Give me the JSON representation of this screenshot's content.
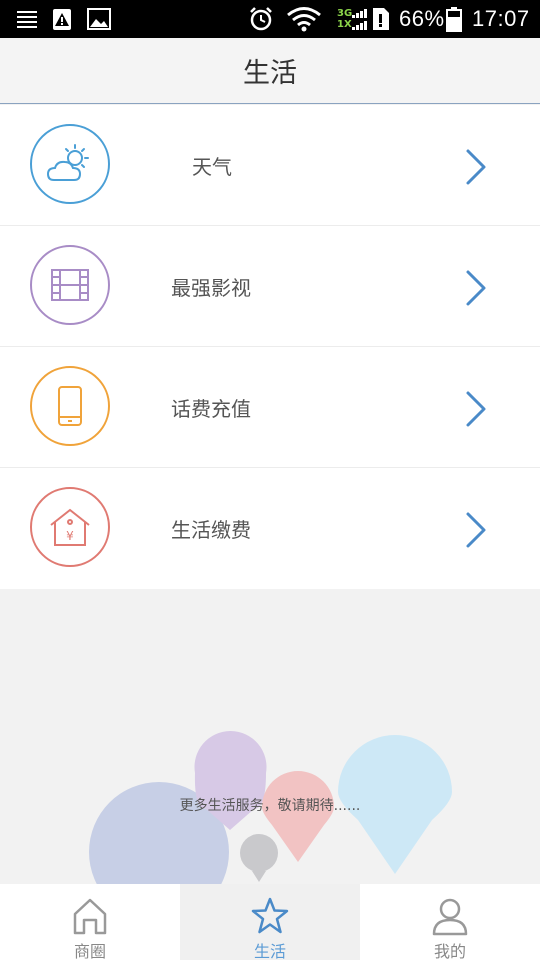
{
  "status_bar": {
    "battery": "66%",
    "time": "17:07",
    "network_top": "3G",
    "network_bottom": "1X"
  },
  "header": {
    "title": "生活"
  },
  "services": [
    {
      "label": "天气",
      "icon": "weather-icon",
      "color": "#4a9fd6"
    },
    {
      "label": "最强影视",
      "icon": "film-icon",
      "color": "#a88cc6"
    },
    {
      "label": "话费充值",
      "icon": "phone-icon",
      "color": "#f0a33a"
    },
    {
      "label": "生活缴费",
      "icon": "house-icon",
      "color": "#e07a72"
    }
  ],
  "empty_message": "更多生活服务，敬请期待......",
  "tabs": [
    {
      "label": "商圈",
      "icon": "home-icon",
      "active": false
    },
    {
      "label": "生活",
      "icon": "star-icon",
      "active": true
    },
    {
      "label": "我的",
      "icon": "user-icon",
      "active": false
    }
  ],
  "colors": {
    "accent": "#5b9bd5",
    "chevron": "#4a8ac8"
  }
}
